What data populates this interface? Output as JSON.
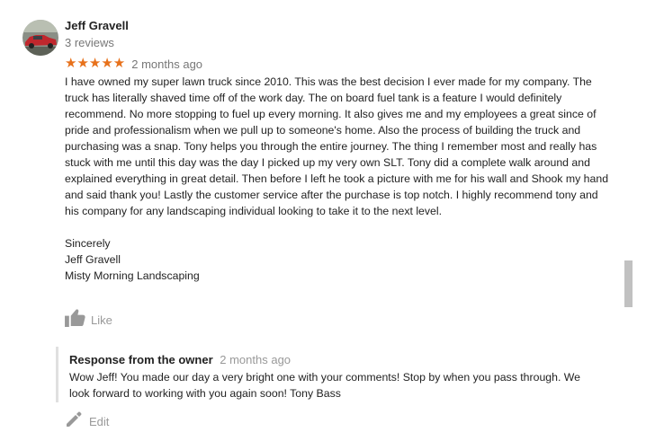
{
  "review": {
    "author_name": "Jeff Gravell",
    "review_count": "3 reviews",
    "rating": 5,
    "stars": "★★★★★",
    "date": "2 months ago",
    "text": "I have owned my super lawn truck since 2010. This was the best decision I ever made for my company. The truck has literally shaved time off of the work day. The on board fuel tank is a feature I would definitely recommend. No more stopping to fuel up every morning. It also gives me and my employees a great since of pride and professionalism when we pull up to someone's home. Also the process of building the truck and purchasing was a snap. Tony helps you through the entire journey. The thing I remember most and really has stuck with me until this day was the day I picked up my very own SLT. Tony did a complete walk around and explained everything in great detail. Then before I left he took a picture with me for his wall and Shook my hand and said thank you! Lastly the customer service after the purchase is top notch. I highly recommend tony and his company for any landscaping individual looking to take it to the next level.",
    "signoff": "Sincerely",
    "signature_name": "Jeff Gravell",
    "signature_company": "Misty Morning Landscaping"
  },
  "actions": {
    "like_label": "Like",
    "edit_label": "Edit"
  },
  "owner_response": {
    "title": "Response from the owner",
    "date": "2 months ago",
    "text": "Wow Jeff! You made our day a very bright one with your comments! Stop by when you pass through. We look forward to working with you again soon! Tony Bass"
  },
  "colors": {
    "star": "#e7711b",
    "muted_text": "#777777",
    "icon_gray": "#999999",
    "scrollbar": "#c1c1c1"
  },
  "icons": {
    "like": "thumbs-up-icon",
    "edit": "pencil-icon"
  }
}
